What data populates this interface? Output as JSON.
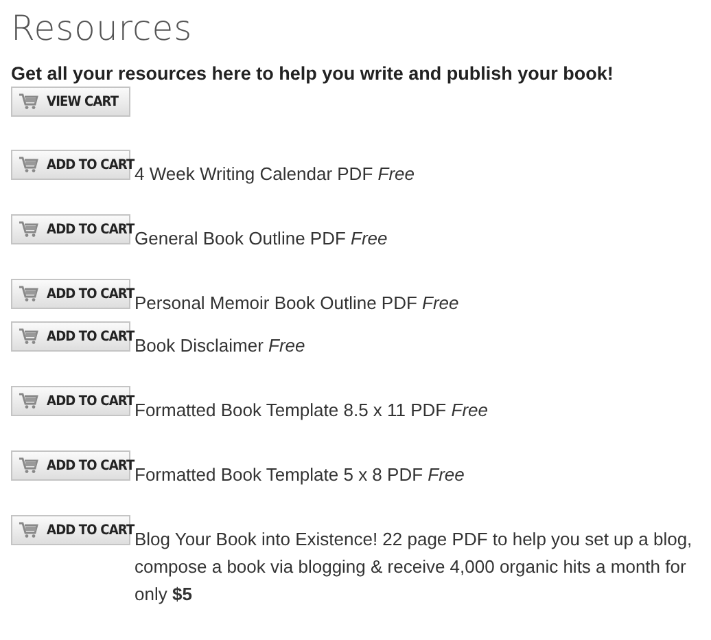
{
  "title": "Resources",
  "intro": "Get all your resources here to help you write and publish your book!",
  "view_cart_button": "VIEW CART",
  "groups": [
    {
      "items": [
        {
          "button": "ADD TO CART",
          "text": "4 Week Writing Calendar PDF *Free*"
        }
      ]
    },
    {
      "items": [
        {
          "button": "ADD TO CART",
          "text": "General Book Outline PDF *Free*"
        }
      ]
    },
    {
      "items": [
        {
          "button": "ADD TO CART",
          "text": "Personal Memoir Book Outline PDF *Free*"
        },
        {
          "button": "ADD TO CART",
          "text": "Book Disclaimer *Free*"
        }
      ]
    },
    {
      "items": [
        {
          "button": "ADD TO CART",
          "text": "Formatted Book Template 8.5 x 11 PDF *Free*"
        }
      ]
    },
    {
      "items": [
        {
          "button": "ADD TO CART",
          "text": "Formatted Book Template 5 x 8 PDF *Free*"
        }
      ]
    },
    {
      "items": [
        {
          "button": "ADD TO CART",
          "text": "Blog Your Book into Existence! 22 page PDF to help you set up a blog, compose a book via blogging & receive 4,000 organic hits a month for only **$5**"
        }
      ]
    }
  ]
}
